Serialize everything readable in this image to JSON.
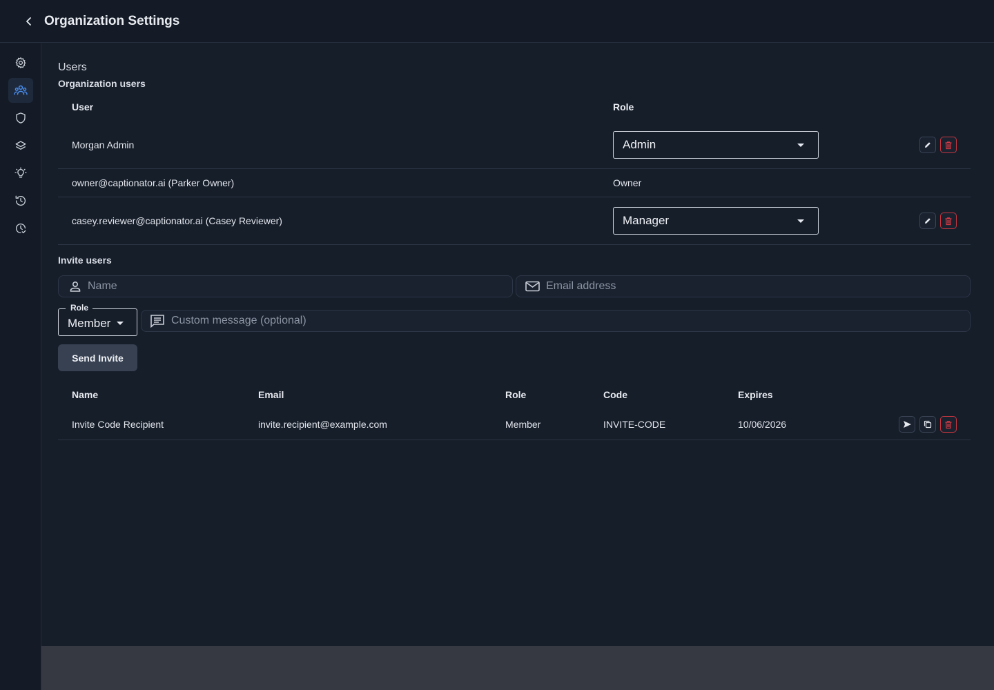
{
  "header": {
    "title": "Organization Settings"
  },
  "sidebar": {
    "items": [
      {
        "icon": "gear-icon",
        "active": false
      },
      {
        "icon": "users-icon",
        "active": true
      },
      {
        "icon": "shield-icon",
        "active": false
      },
      {
        "icon": "layers-icon",
        "active": false
      },
      {
        "icon": "lightbulb-icon",
        "active": false
      },
      {
        "icon": "history-icon",
        "active": false
      },
      {
        "icon": "clock-check-icon",
        "active": false
      }
    ]
  },
  "users": {
    "title": "Users",
    "subtitle": "Organization users",
    "columns": {
      "user": "User",
      "role": "Role"
    },
    "rows": [
      {
        "user": "Morgan Admin",
        "role": "Admin",
        "editable": true
      },
      {
        "user": "owner@captionator.ai (Parker Owner)",
        "role": "Owner",
        "editable": false
      },
      {
        "user": "casey.reviewer@captionator.ai (Casey Reviewer)",
        "role": "Manager",
        "editable": true
      }
    ]
  },
  "invite": {
    "title": "Invite users",
    "name_placeholder": "Name",
    "email_placeholder": "Email address",
    "role_label": "Role",
    "role_value": "Member",
    "message_placeholder": "Custom message (optional)",
    "send_label": "Send Invite"
  },
  "invites_table": {
    "columns": {
      "name": "Name",
      "email": "Email",
      "role": "Role",
      "code": "Code",
      "expires": "Expires"
    },
    "rows": [
      {
        "name": "Invite Code Recipient",
        "email": "invite.recipient@example.com",
        "role": "Member",
        "code": "INVITE-CODE",
        "expires": "10/06/2026"
      }
    ]
  },
  "colors": {
    "background": "#161e2a",
    "accent": "#4a8ef0",
    "danger": "#d93a44"
  }
}
